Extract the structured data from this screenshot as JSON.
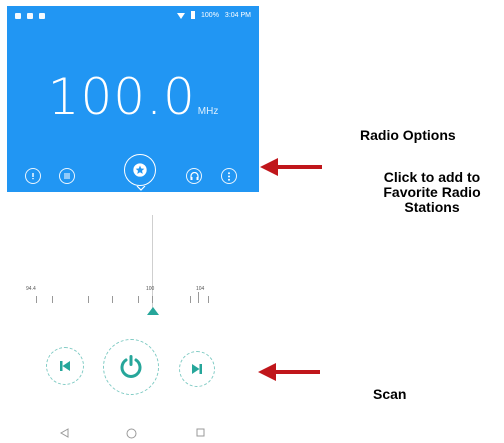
{
  "status": {
    "time": "3:04 PM",
    "battery": "100%"
  },
  "radio": {
    "frequency": "100.0",
    "unit": "MHz"
  },
  "controls": {
    "left": [
      "info-icon",
      "list-icon"
    ],
    "center": "star-icon",
    "right": [
      "headset-icon",
      "more-options-icon"
    ]
  },
  "scale": {
    "labels": [
      "94.4",
      "100",
      "104"
    ]
  },
  "annotations": {
    "radio_options": "Radio Options",
    "favorite": "Click to add to Favorite Radio Stations",
    "scan": "Scan"
  },
  "colors": {
    "screen": "#2196f3",
    "accent": "#26a69a",
    "arrow": "#c0161b"
  }
}
